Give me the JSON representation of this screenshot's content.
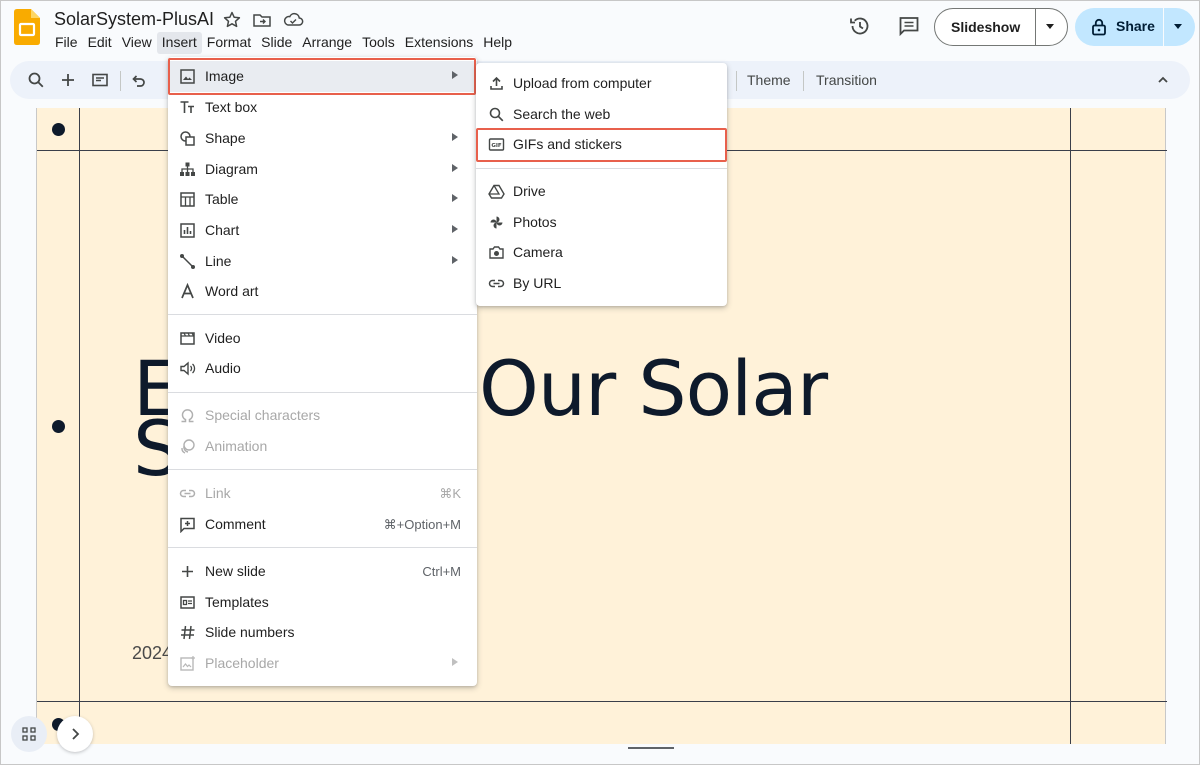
{
  "app": {
    "title": "SolarSystem-PlusAI",
    "logo_icon": "google-slides-logo",
    "brand_color": "#f9ab00"
  },
  "menubar": {
    "items": [
      "File",
      "Edit",
      "View",
      "Insert",
      "Format",
      "Slide",
      "Arrange",
      "Tools",
      "Extensions",
      "Help"
    ],
    "active": "Insert"
  },
  "header": {
    "slideshow_label": "Slideshow",
    "share_label": "Share",
    "share_color": "#c2e7ff"
  },
  "toolbar": {
    "theme_label": "Theme",
    "transition_label": "Transition"
  },
  "slide": {
    "title_visible": "E     Our Solar\nS",
    "title_line1_left": "E",
    "title_line1_right": "Our Solar",
    "title_line2": "S",
    "year_visible": "2024",
    "background": "#fff2d9"
  },
  "insert_menu": {
    "groups": [
      [
        {
          "label": "Image",
          "icon": "image-icon",
          "submenu": true,
          "highlighted": true
        },
        {
          "label": "Text box",
          "icon": "text-box-icon"
        },
        {
          "label": "Shape",
          "icon": "shape-icon",
          "submenu": true
        },
        {
          "label": "Diagram",
          "icon": "diagram-icon",
          "submenu": true
        },
        {
          "label": "Table",
          "icon": "table-icon",
          "submenu": true
        },
        {
          "label": "Chart",
          "icon": "chart-icon",
          "submenu": true
        },
        {
          "label": "Line",
          "icon": "line-icon",
          "submenu": true
        },
        {
          "label": "Word art",
          "icon": "word-art-icon"
        }
      ],
      [
        {
          "label": "Video",
          "icon": "video-icon"
        },
        {
          "label": "Audio",
          "icon": "audio-icon"
        }
      ],
      [
        {
          "label": "Special characters",
          "icon": "omega-icon",
          "disabled": true
        },
        {
          "label": "Animation",
          "icon": "animation-icon",
          "disabled": true
        }
      ],
      [
        {
          "label": "Link",
          "icon": "link-icon",
          "shortcut": "⌘K",
          "disabled": true
        },
        {
          "label": "Comment",
          "icon": "comment-add-icon",
          "shortcut": "⌘+Option+M"
        }
      ],
      [
        {
          "label": "New slide",
          "icon": "plus-icon",
          "shortcut": "Ctrl+M"
        },
        {
          "label": "Templates",
          "icon": "templates-icon"
        },
        {
          "label": "Slide numbers",
          "icon": "hash-icon"
        },
        {
          "label": "Placeholder",
          "icon": "placeholder-icon",
          "submenu": true,
          "disabled": true
        }
      ]
    ]
  },
  "image_submenu": {
    "groups": [
      [
        {
          "label": "Upload from computer",
          "icon": "upload-icon"
        },
        {
          "label": "Search the web",
          "icon": "search-icon"
        },
        {
          "label": "GIFs and stickers",
          "icon": "gif-icon",
          "highlighted": true
        }
      ],
      [
        {
          "label": "Drive",
          "icon": "drive-icon"
        },
        {
          "label": "Photos",
          "icon": "photos-icon"
        },
        {
          "label": "Camera",
          "icon": "camera-icon"
        },
        {
          "label": "By URL",
          "icon": "link-icon"
        }
      ]
    ]
  },
  "highlight_color": "#e8604c"
}
